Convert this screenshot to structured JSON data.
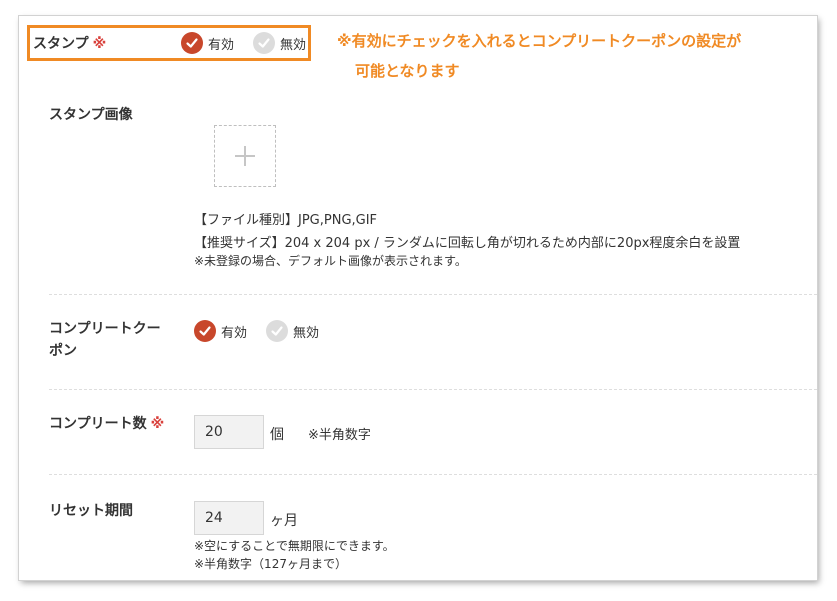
{
  "stamp": {
    "title": "スタンプ",
    "required_mark": "※",
    "options": [
      {
        "label": "有効",
        "checked": true
      },
      {
        "label": "無効",
        "checked": false
      }
    ]
  },
  "callout": {
    "line1": "※有効にチェックを入れるとコンプリートクーポンの設定が",
    "line2": "可能となります"
  },
  "stamp_image": {
    "label": "スタンプ画像",
    "upload_icon": "plus-icon",
    "notes": [
      "【ファイル種別】JPG,PNG,GIF",
      "【推奨サイズ】204 x 204 px / ランダムに回転し角が切れるため内部に20px程度余白を設置",
      "※未登録の場合、デフォルト画像が表示されます。"
    ]
  },
  "complete_coupon": {
    "label_line1": "コンプリートクー",
    "label_line2": "ポン",
    "options": [
      {
        "label": "有効",
        "checked": true
      },
      {
        "label": "無効",
        "checked": false
      }
    ]
  },
  "complete_count": {
    "label": "コンプリート数",
    "required_mark": "※",
    "value": "20",
    "unit": "個",
    "hint": "※半角数字"
  },
  "reset_period": {
    "label": "リセット期間",
    "value": "24",
    "unit": "ヶ月",
    "notes": [
      "※空にすることで無期限にできます。",
      "※半角数字（127ヶ月まで）"
    ]
  },
  "colors": {
    "accent": "#f08a24",
    "required": "#d9413c",
    "radio_on": "#c8472b",
    "radio_off": "#dcdcdc"
  }
}
